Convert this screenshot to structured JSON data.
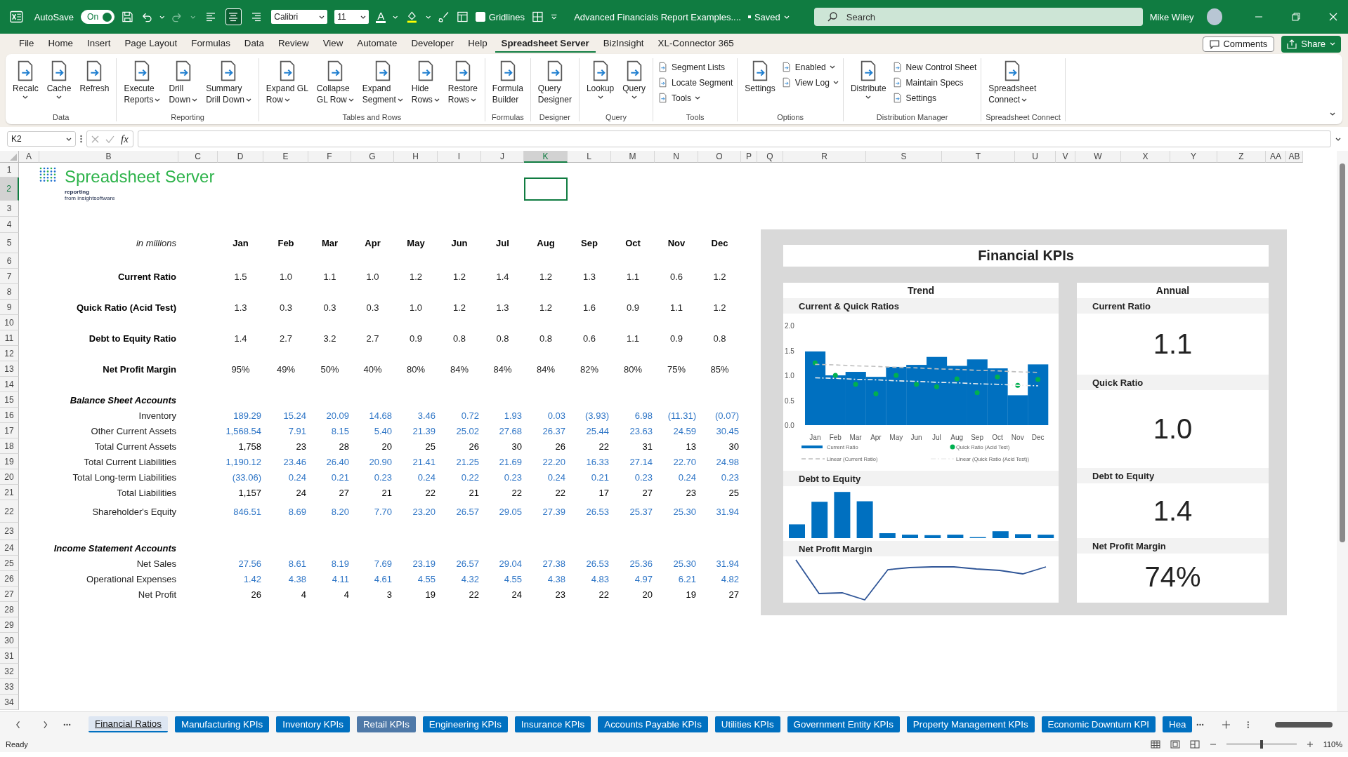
{
  "window": {
    "autosave_label": "AutoSave",
    "autosave_on": true,
    "autosave_state": "On",
    "align_buttons": [
      {
        "selected": false
      },
      {
        "selected": true
      },
      {
        "selected": false
      }
    ],
    "font_name": "Calibri",
    "font_size": "11",
    "font_color_label": "A",
    "gridlines": {
      "label": "Gridlines",
      "checked": false
    },
    "title": "Advanced Financials Report Examples....",
    "save_status": "Saved",
    "search_placeholder": "Search",
    "user": "Mike Wiley"
  },
  "menu": [
    {
      "label": "File",
      "selected": false
    },
    {
      "label": "Home",
      "selected": false
    },
    {
      "label": "Insert",
      "selected": false
    },
    {
      "label": "Page Layout",
      "selected": false
    },
    {
      "label": "Formulas",
      "selected": false
    },
    {
      "label": "Data",
      "selected": false
    },
    {
      "label": "Review",
      "selected": false
    },
    {
      "label": "View",
      "selected": false
    },
    {
      "label": "Automate",
      "selected": false
    },
    {
      "label": "Developer",
      "selected": false
    },
    {
      "label": "Help",
      "selected": false
    },
    {
      "label": "Spreadsheet Server",
      "selected": true
    },
    {
      "label": "BizInsight",
      "selected": false
    },
    {
      "label": "XL-Connector 365",
      "selected": false
    }
  ],
  "comments": "Comments",
  "share": "Share",
  "ribbon": [
    {
      "label": "Data",
      "items": [
        {
          "kind": "large",
          "lines": [
            "Recalc"
          ],
          "dropdown": true
        },
        {
          "kind": "large",
          "lines": [
            "Cache"
          ],
          "dropdown": true
        },
        {
          "kind": "large",
          "lines": [
            "Refresh"
          ],
          "dropdown": false
        }
      ]
    },
    {
      "label": "Reporting",
      "items": [
        {
          "kind": "large",
          "lines": [
            "Execute",
            "Reports"
          ],
          "dropdown": true
        },
        {
          "kind": "large",
          "lines": [
            "Drill",
            "Down"
          ],
          "dropdown": true
        },
        {
          "kind": "large",
          "lines": [
            "Summary",
            "Drill Down"
          ],
          "dropdown": true
        }
      ]
    },
    {
      "label": "Tables and Rows",
      "items": [
        {
          "kind": "large",
          "lines": [
            "Expand GL",
            "Row"
          ],
          "dropdown": true
        },
        {
          "kind": "large",
          "lines": [
            "Collapse",
            "GL Row"
          ],
          "dropdown": true
        },
        {
          "kind": "large",
          "lines": [
            "Expand",
            "Segment"
          ],
          "dropdown": true
        },
        {
          "kind": "large",
          "lines": [
            "Hide",
            "Rows"
          ],
          "dropdown": true
        },
        {
          "kind": "large",
          "lines": [
            "Restore",
            "Rows"
          ],
          "dropdown": true
        }
      ]
    },
    {
      "label": "Formulas",
      "items": [
        {
          "kind": "large",
          "lines": [
            "Formula",
            "Builder"
          ],
          "dropdown": false
        }
      ]
    },
    {
      "label": "Designer",
      "items": [
        {
          "kind": "large",
          "lines": [
            "Query",
            "Designer"
          ],
          "dropdown": false
        }
      ]
    },
    {
      "label": "Query",
      "items": [
        {
          "kind": "large",
          "lines": [
            "Lookup"
          ],
          "dropdown": true
        },
        {
          "kind": "large",
          "lines": [
            "Query"
          ],
          "dropdown": true
        }
      ]
    },
    {
      "label": "Tools",
      "items": [
        {
          "kind": "small",
          "lines": [
            "Segment Lists"
          ],
          "dropdown": false
        },
        {
          "kind": "small",
          "lines": [
            "Locate Segment"
          ],
          "dropdown": false
        },
        {
          "kind": "small",
          "lines": [
            "Tools"
          ],
          "dropdown": true
        }
      ]
    },
    {
      "label": "Options",
      "items": [
        {
          "kind": "large",
          "lines": [
            "Settings"
          ],
          "dropdown": false
        },
        {
          "kind": "small",
          "lines": [
            "Enabled"
          ],
          "dropdown": true
        },
        {
          "kind": "small",
          "lines": [
            "View Log"
          ],
          "dropdown": true
        }
      ]
    },
    {
      "label": "Distribution Manager",
      "items": [
        {
          "kind": "large",
          "lines": [
            "Distribute"
          ],
          "dropdown": true
        },
        {
          "kind": "small",
          "lines": [
            "New Control Sheet"
          ],
          "dropdown": false
        },
        {
          "kind": "small",
          "lines": [
            "Maintain Specs"
          ],
          "dropdown": false
        },
        {
          "kind": "small",
          "lines": [
            "Settings"
          ],
          "dropdown": false
        }
      ]
    },
    {
      "label": "Spreadsheet Connect",
      "items": [
        {
          "kind": "large",
          "lines": [
            "Spreadsheet",
            "Connect"
          ],
          "dropdown": true
        }
      ]
    }
  ],
  "formula_bar": {
    "name_box": "K2",
    "function_label": "fx"
  },
  "columns": [
    {
      "letter": "A",
      "selected": false
    },
    {
      "letter": "B",
      "selected": false
    },
    {
      "letter": "C",
      "selected": false
    },
    {
      "letter": "D",
      "selected": false
    },
    {
      "letter": "E",
      "selected": false
    },
    {
      "letter": "F",
      "selected": false
    },
    {
      "letter": "G",
      "selected": false
    },
    {
      "letter": "H",
      "selected": false
    },
    {
      "letter": "I",
      "selected": false
    },
    {
      "letter": "J",
      "selected": false
    },
    {
      "letter": "K",
      "selected": true
    },
    {
      "letter": "L",
      "selected": false
    },
    {
      "letter": "M",
      "selected": false
    },
    {
      "letter": "N",
      "selected": false
    },
    {
      "letter": "O",
      "selected": false
    },
    {
      "letter": "P",
      "selected": false
    },
    {
      "letter": "Q",
      "selected": false
    },
    {
      "letter": "R",
      "selected": false
    },
    {
      "letter": "S",
      "selected": false
    },
    {
      "letter": "T",
      "selected": false
    },
    {
      "letter": "U",
      "selected": false
    },
    {
      "letter": "V",
      "selected": false
    },
    {
      "letter": "W",
      "selected": false
    },
    {
      "letter": "X",
      "selected": false
    },
    {
      "letter": "Y",
      "selected": false
    },
    {
      "letter": "Z",
      "selected": false
    },
    {
      "letter": "AA",
      "selected": false
    },
    {
      "letter": "AB",
      "selected": false
    }
  ],
  "logo": {
    "name": "Spreadsheet Server",
    "line1": "reporting",
    "line2": "from insightsoftware"
  },
  "rows": [
    {
      "number": "1",
      "selected": false
    },
    {
      "number": "2",
      "selected": true
    },
    {
      "number": "3",
      "selected": false
    },
    {
      "number": "4",
      "selected": false
    },
    {
      "number": "5",
      "selected": false,
      "kind": "header",
      "label": "in millions",
      "values": [
        "Jan",
        "Feb",
        "Mar",
        "Apr",
        "May",
        "Jun",
        "Jul",
        "Aug",
        "Sep",
        "Oct",
        "Nov",
        "Dec"
      ]
    },
    {
      "number": "6",
      "selected": false
    },
    {
      "number": "7",
      "selected": false,
      "kind": "ratio",
      "label": "Current Ratio",
      "values": [
        "1.5",
        "1.0",
        "1.1",
        "1.0",
        "1.2",
        "1.2",
        "1.4",
        "1.2",
        "1.3",
        "1.1",
        "0.6",
        "1.2"
      ]
    },
    {
      "number": "8",
      "selected": false
    },
    {
      "number": "9",
      "selected": false,
      "kind": "ratio",
      "label": "Quick Ratio (Acid Test)",
      "values": [
        "1.3",
        "0.3",
        "0.3",
        "0.3",
        "1.0",
        "1.2",
        "1.3",
        "1.2",
        "1.6",
        "0.9",
        "1.1",
        "1.2"
      ]
    },
    {
      "number": "10",
      "selected": false
    },
    {
      "number": "11",
      "selected": false,
      "kind": "ratio",
      "label": "Debt to Equity Ratio",
      "values": [
        "1.4",
        "2.7",
        "3.2",
        "2.7",
        "0.9",
        "0.8",
        "0.8",
        "0.8",
        "0.6",
        "1.1",
        "0.9",
        "0.8"
      ]
    },
    {
      "number": "12",
      "selected": false
    },
    {
      "number": "13",
      "selected": false,
      "kind": "ratio",
      "label": "Net Profit Margin",
      "values": [
        "95%",
        "49%",
        "50%",
        "40%",
        "80%",
        "84%",
        "84%",
        "84%",
        "82%",
        "80%",
        "75%",
        "85%"
      ]
    },
    {
      "number": "14",
      "selected": false
    },
    {
      "number": "15",
      "selected": false,
      "kind": "section",
      "label": "Balance Sheet Accounts"
    },
    {
      "number": "16",
      "selected": false,
      "kind": "input",
      "label": "Inventory",
      "values": [
        "189.29",
        "15.24",
        "20.09",
        "14.68",
        "3.46",
        "0.72",
        "1.93",
        "0.03",
        "(3.93)",
        "6.98",
        "(11.31)",
        "(0.07)"
      ]
    },
    {
      "number": "17",
      "selected": false,
      "kind": "input",
      "label": "Other Current Assets",
      "values": [
        "1,568.54",
        "7.91",
        "8.15",
        "5.40",
        "21.39",
        "25.02",
        "27.68",
        "26.37",
        "25.44",
        "23.63",
        "24.59",
        "30.45"
      ]
    },
    {
      "number": "18",
      "selected": false,
      "kind": "total",
      "label": "Total Current Assets",
      "values": [
        "1,758",
        "23",
        "28",
        "20",
        "25",
        "26",
        "30",
        "26",
        "22",
        "31",
        "13",
        "30"
      ]
    },
    {
      "number": "19",
      "selected": false,
      "kind": "input",
      "label": "Total Current Liabilities",
      "values": [
        "1,190.12",
        "23.46",
        "26.40",
        "20.90",
        "21.41",
        "21.25",
        "21.69",
        "22.20",
        "16.33",
        "27.14",
        "22.70",
        "24.98"
      ]
    },
    {
      "number": "20",
      "selected": false,
      "kind": "input",
      "label": "Total Long-term Liabilities",
      "values": [
        "(33.06)",
        "0.24",
        "0.21",
        "0.23",
        "0.24",
        "0.22",
        "0.23",
        "0.24",
        "0.21",
        "0.23",
        "0.24",
        "0.23"
      ]
    },
    {
      "number": "21",
      "selected": false,
      "kind": "total",
      "label": "Total Liabilities",
      "values": [
        "1,157",
        "24",
        "27",
        "21",
        "22",
        "21",
        "22",
        "22",
        "17",
        "27",
        "23",
        "25"
      ]
    },
    {
      "number": "22",
      "selected": false,
      "kind": "input",
      "label": "Shareholder's Equity",
      "values": [
        "846.51",
        "8.69",
        "8.20",
        "7.70",
        "23.20",
        "26.57",
        "29.05",
        "27.39",
        "26.53",
        "25.37",
        "25.30",
        "31.94"
      ]
    },
    {
      "number": "23",
      "selected": false
    },
    {
      "number": "24",
      "selected": false,
      "kind": "section",
      "label": "Income Statement Accounts"
    },
    {
      "number": "25",
      "selected": false,
      "kind": "input",
      "label": "Net Sales",
      "values": [
        "27.56",
        "8.61",
        "8.19",
        "7.69",
        "23.19",
        "26.57",
        "29.04",
        "27.38",
        "26.53",
        "25.36",
        "25.30",
        "31.94"
      ]
    },
    {
      "number": "26",
      "selected": false,
      "kind": "input",
      "label": "Operational Expenses",
      "values": [
        "1.42",
        "4.38",
        "4.11",
        "4.61",
        "4.55",
        "4.32",
        "4.55",
        "4.38",
        "4.83",
        "4.97",
        "6.21",
        "4.82"
      ]
    },
    {
      "number": "27",
      "selected": false,
      "kind": "total",
      "label": "Net Profit",
      "values": [
        "26",
        "4",
        "4",
        "3",
        "19",
        "22",
        "24",
        "23",
        "22",
        "20",
        "19",
        "27"
      ]
    },
    {
      "number": "28",
      "selected": false
    },
    {
      "number": "29",
      "selected": false
    },
    {
      "number": "30",
      "selected": false
    },
    {
      "number": "31",
      "selected": false
    },
    {
      "number": "32",
      "selected": false
    },
    {
      "number": "33",
      "selected": false
    },
    {
      "number": "34",
      "selected": false
    }
  ],
  "kpi": {
    "title": "Financial KPIs",
    "trend": {
      "heading": "Trend",
      "sections": [
        {
          "title": "Current & Quick Ratios",
          "kind": "combo",
          "chart_data": {
            "type": "bar",
            "categories": [
              "Jan",
              "Feb",
              "Mar",
              "Apr",
              "May",
              "Jun",
              "Jul",
              "Aug",
              "Sep",
              "Oct",
              "Nov",
              "Dec"
            ],
            "ylim": [
              0,
              2
            ],
            "yticks": [
              {
                "value": 0,
                "label": "0.0"
              },
              {
                "value": 0.5,
                "label": "0.5"
              },
              {
                "value": 1,
                "label": "1.0"
              },
              {
                "value": 1.5,
                "label": "1.5"
              },
              {
                "value": 2,
                "label": "2.0"
              }
            ],
            "series": [
              {
                "name": "Current Ratio",
                "type": "bar",
                "color": "#0070c0",
                "values": [
                  1.48,
                  1.0,
                  1.07,
                  0.97,
                  1.17,
                  1.21,
                  1.37,
                  1.19,
                  1.32,
                  1.14,
                  0.6,
                  1.22
                ]
              },
              {
                "name": "Quick Ratio (Acid Test)",
                "type": "scatter",
                "color": "#00b050",
                "values": [
                  1.25,
                  1.0,
                  0.82,
                  0.63,
                  1.0,
                  0.82,
                  0.77,
                  0.93,
                  0.65,
                  0.97,
                  0.8,
                  0.92
                ]
              },
              {
                "name": "Linear (Current Ratio)",
                "type": "line",
                "line_style": "dashed",
                "color": "#bfbfbf",
                "values": [
                  1.22,
                  1.21,
                  1.19,
                  1.18,
                  1.16,
                  1.15,
                  1.13,
                  1.12,
                  1.1,
                  1.09,
                  1.07,
                  1.06
                ]
              },
              {
                "name": "Linear (Quick Ratio (Acid Test))",
                "type": "line",
                "line_style": "dashdot",
                "color": "#eeeeee",
                "values": [
                  0.95,
                  0.94,
                  0.92,
                  0.91,
                  0.89,
                  0.88,
                  0.86,
                  0.85,
                  0.83,
                  0.82,
                  0.8,
                  0.79
                ]
              }
            ],
            "legend": true
          }
        },
        {
          "title": "Debt to Equity",
          "kind": "bars"
        },
        {
          "title": "Net Profit Margin",
          "kind": "line"
        }
      ]
    },
    "annual": {
      "heading": "Annual",
      "items": [
        {
          "label": "Current Ratio",
          "value": "1.1"
        },
        {
          "label": "Quick Ratio",
          "value": "1.0"
        },
        {
          "label": "Debt to Equity",
          "value": "1.4"
        },
        {
          "label": "Net Profit Margin",
          "value": "74%"
        }
      ]
    }
  },
  "sheet_tabs": [
    {
      "label": "Financial Ratios",
      "selected": true,
      "color": "#0070c0"
    },
    {
      "label": "Manufacturing KPIs",
      "selected": false,
      "color": "#0070c0"
    },
    {
      "label": "Inventory KPIs",
      "selected": false,
      "color": "#0070c0"
    },
    {
      "label": "Retail KPIs",
      "selected": false,
      "color": "#4f79a8"
    },
    {
      "label": "Engineering KPIs",
      "selected": false,
      "color": "#0070c0"
    },
    {
      "label": "Insurance KPIs",
      "selected": false,
      "color": "#0070c0"
    },
    {
      "label": "Accounts Payable KPIs",
      "selected": false,
      "color": "#0070c0"
    },
    {
      "label": "Utilities KPIs",
      "selected": false,
      "color": "#0070c0"
    },
    {
      "label": "Government Entity KPIs",
      "selected": false,
      "color": "#0070c0"
    },
    {
      "label": "Property Management KPIs",
      "selected": false,
      "color": "#0070c0"
    },
    {
      "label": "Economic Downturn KPI",
      "selected": false,
      "color": "#0070c0"
    },
    {
      "label": "Hea",
      "selected": false,
      "color": "#0070c0"
    }
  ],
  "status_bar": {
    "status": "Ready",
    "zoom": {
      "level": 0.5,
      "reading": "110%"
    }
  }
}
